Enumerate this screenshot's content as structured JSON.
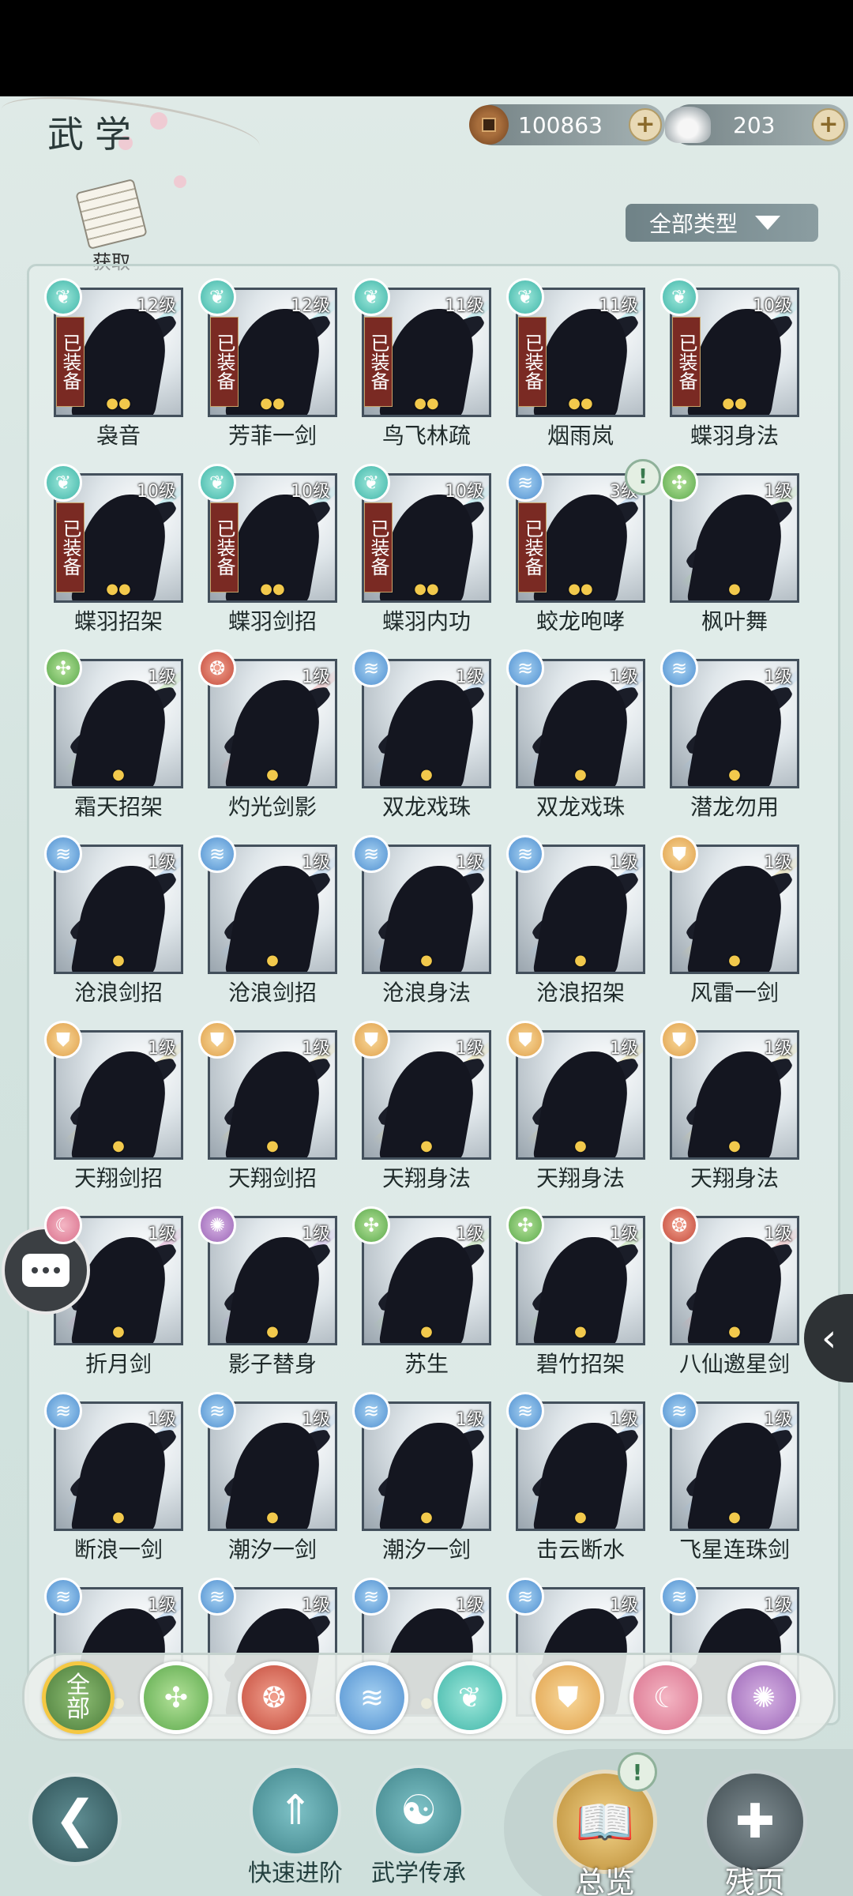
{
  "header": {
    "title": "武学",
    "copper": "100863",
    "silver": "203",
    "acquire_label": "获取",
    "type_filter": "全部类型"
  },
  "skills": [
    {
      "name": "袅音",
      "level": "12级",
      "equipped": true,
      "badge": "butterfly"
    },
    {
      "name": "芳菲一剑",
      "level": "12级",
      "equipped": true,
      "badge": "butterfly"
    },
    {
      "name": "鸟飞林疏",
      "level": "11级",
      "equipped": true,
      "badge": "butterfly"
    },
    {
      "name": "烟雨岚",
      "level": "11级",
      "equipped": true,
      "badge": "butterfly"
    },
    {
      "name": "蝶羽身法",
      "level": "10级",
      "equipped": true,
      "badge": "butterfly"
    },
    {
      "name": "蝶羽招架",
      "level": "10级",
      "equipped": true,
      "badge": "butterfly"
    },
    {
      "name": "蝶羽剑招",
      "level": "10级",
      "equipped": true,
      "badge": "butterfly"
    },
    {
      "name": "蝶羽内功",
      "level": "10级",
      "equipped": true,
      "badge": "butterfly"
    },
    {
      "name": "蛟龙咆哮",
      "level": "3级",
      "equipped": true,
      "badge": "wave",
      "alert": true
    },
    {
      "name": "枫叶舞",
      "level": "1级",
      "equipped": false,
      "badge": "leaf"
    },
    {
      "name": "霜天招架",
      "level": "1级",
      "equipped": false,
      "badge": "leaf"
    },
    {
      "name": "灼光剑影",
      "level": "1级",
      "equipped": false,
      "badge": "flame"
    },
    {
      "name": "双龙戏珠",
      "level": "1级",
      "equipped": false,
      "badge": "wave"
    },
    {
      "name": "双龙戏珠",
      "level": "1级",
      "equipped": false,
      "badge": "wave"
    },
    {
      "name": "潜龙勿用",
      "level": "1级",
      "equipped": false,
      "badge": "wave"
    },
    {
      "name": "沧浪剑招",
      "level": "1级",
      "equipped": false,
      "badge": "wave"
    },
    {
      "name": "沧浪剑招",
      "level": "1级",
      "equipped": false,
      "badge": "wave"
    },
    {
      "name": "沧浪身法",
      "level": "1级",
      "equipped": false,
      "badge": "wave"
    },
    {
      "name": "沧浪招架",
      "level": "1级",
      "equipped": false,
      "badge": "wave"
    },
    {
      "name": "风雷一剑",
      "level": "1级",
      "equipped": false,
      "badge": "shield"
    },
    {
      "name": "天翔剑招",
      "level": "1级",
      "equipped": false,
      "badge": "shield"
    },
    {
      "name": "天翔剑招",
      "level": "1级",
      "equipped": false,
      "badge": "shield"
    },
    {
      "name": "天翔身法",
      "level": "1级",
      "equipped": false,
      "badge": "shield"
    },
    {
      "name": "天翔身法",
      "level": "1级",
      "equipped": false,
      "badge": "shield"
    },
    {
      "name": "天翔身法",
      "level": "1级",
      "equipped": false,
      "badge": "shield"
    },
    {
      "name": "折月剑",
      "level": "1级",
      "equipped": false,
      "badge": "moon"
    },
    {
      "name": "影子替身",
      "level": "1级",
      "equipped": false,
      "badge": "swirl"
    },
    {
      "name": "苏生",
      "level": "1级",
      "equipped": false,
      "badge": "leaf"
    },
    {
      "name": "碧竹招架",
      "level": "1级",
      "equipped": false,
      "badge": "leaf"
    },
    {
      "name": "八仙邀星剑",
      "level": "1级",
      "equipped": false,
      "badge": "flame"
    },
    {
      "name": "断浪一剑",
      "level": "1级",
      "equipped": false,
      "badge": "wave"
    },
    {
      "name": "潮汐一剑",
      "level": "1级",
      "equipped": false,
      "badge": "wave"
    },
    {
      "name": "潮汐一剑",
      "level": "1级",
      "equipped": false,
      "badge": "wave"
    },
    {
      "name": "击云断水",
      "level": "1级",
      "equipped": false,
      "badge": "wave"
    },
    {
      "name": "飞星连珠剑",
      "level": "1级",
      "equipped": false,
      "badge": "wave"
    },
    {
      "name": "",
      "level": "1级",
      "equipped": false,
      "badge": "wave"
    },
    {
      "name": "",
      "level": "1级",
      "equipped": false,
      "badge": "wave"
    },
    {
      "name": "",
      "level": "1级",
      "equipped": false,
      "badge": "wave"
    },
    {
      "name": "",
      "level": "1级",
      "equipped": false,
      "badge": "wave"
    },
    {
      "name": "",
      "level": "1级",
      "equipped": false,
      "badge": "wave"
    }
  ],
  "equipped_label": "已装备",
  "categories": [
    {
      "id": "all",
      "label_top": "全",
      "label_bottom": "部",
      "selected": true
    },
    {
      "id": "leaf"
    },
    {
      "id": "flame"
    },
    {
      "id": "wave"
    },
    {
      "id": "butterfly"
    },
    {
      "id": "shield"
    },
    {
      "id": "moon"
    },
    {
      "id": "swirl"
    }
  ],
  "bottom_nav": {
    "quick_advance": "快速进阶",
    "inherit": "武学传承",
    "overview": "总览",
    "fragments": "残页"
  },
  "colors": {
    "accent_gold": "#f5c842",
    "equipped_red": "#7a2a23",
    "background": "#dfeae7"
  }
}
